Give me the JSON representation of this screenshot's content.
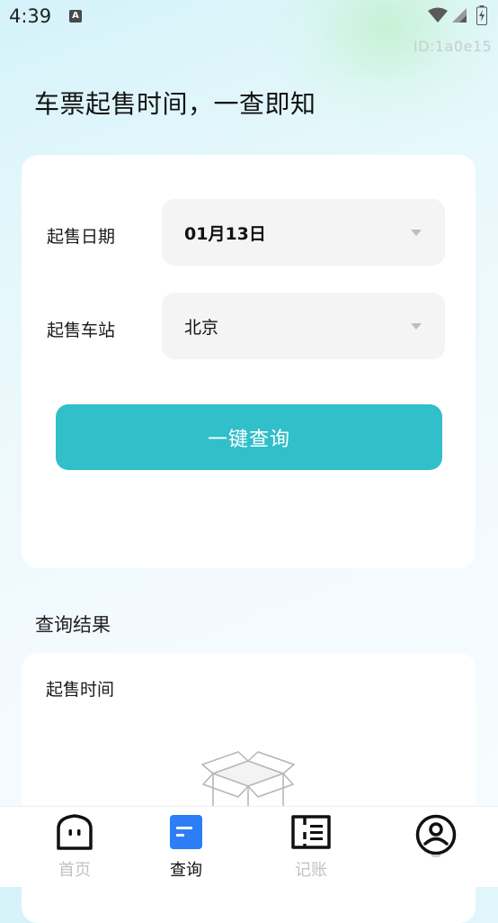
{
  "status_bar": {
    "time": "4:39",
    "notification_icon": "A",
    "id_text": "ID:1a0e15"
  },
  "page": {
    "title": "车票起售时间，一查即知"
  },
  "form": {
    "date_label": "起售日期",
    "date_value": "01月13日",
    "station_label": "起售车站",
    "station_value": "北京",
    "query_button": "一键查询"
  },
  "results": {
    "section_title": "查询结果",
    "time_label": "起售时间",
    "empty_icon": "empty-box-icon"
  },
  "tabs": [
    {
      "label": "首页",
      "icon": "home-face-icon",
      "active": false
    },
    {
      "label": "查询",
      "icon": "query-doc-icon",
      "active": true
    },
    {
      "label": "记账",
      "icon": "ledger-ticket-icon",
      "active": false
    },
    {
      "label": "",
      "icon": "profile-icon",
      "active": false
    }
  ],
  "colors": {
    "accent": "#31bfca",
    "tab_active_icon": "#2d7df6",
    "tab_inactive": "#c2c2c2"
  }
}
